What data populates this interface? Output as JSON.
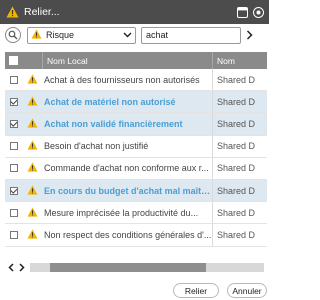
{
  "window": {
    "title": "Relier...",
    "icons": [
      "warning-icon",
      "window-icon",
      "help-icon"
    ]
  },
  "filter": {
    "category": "Risque",
    "search_value": "achat"
  },
  "table": {
    "columns": [
      "Nom Local",
      "Nom"
    ],
    "rows": [
      {
        "name": "Achat à des fournisseurs non autorisés",
        "nom": "Shared D",
        "checked": false,
        "selected": false
      },
      {
        "name": "Achat de matériel non autorisé",
        "nom": "Shared D",
        "checked": true,
        "selected": true
      },
      {
        "name": "Achat non validé financièrement",
        "nom": "Shared D",
        "checked": true,
        "selected": true
      },
      {
        "name": "Besoin d'achat non justifié",
        "nom": "Shared D",
        "checked": false,
        "selected": false
      },
      {
        "name": "Commande d'achat non conforme aux r...",
        "nom": "Shared D",
        "checked": false,
        "selected": false
      },
      {
        "name": "En cours du budget d'achat mal maîtris??",
        "nom": "Shared D",
        "checked": true,
        "selected": true
      },
      {
        "name": "Mesure imprécisée la productivité du...",
        "nom": "Shared D",
        "checked": false,
        "selected": false
      },
      {
        "name": "Non respect des conditions générales d'...",
        "nom": "Shared D",
        "checked": false,
        "selected": false
      }
    ]
  },
  "footer": {
    "relier_label": "Relier",
    "annuler_label": "Annuler"
  },
  "colors": {
    "titlebar": "#4c4c4c",
    "header": "#8a8a8a",
    "selected_row": "#dde8f1",
    "selected_text": "#4a9fd4",
    "warning": "#f2b400"
  }
}
